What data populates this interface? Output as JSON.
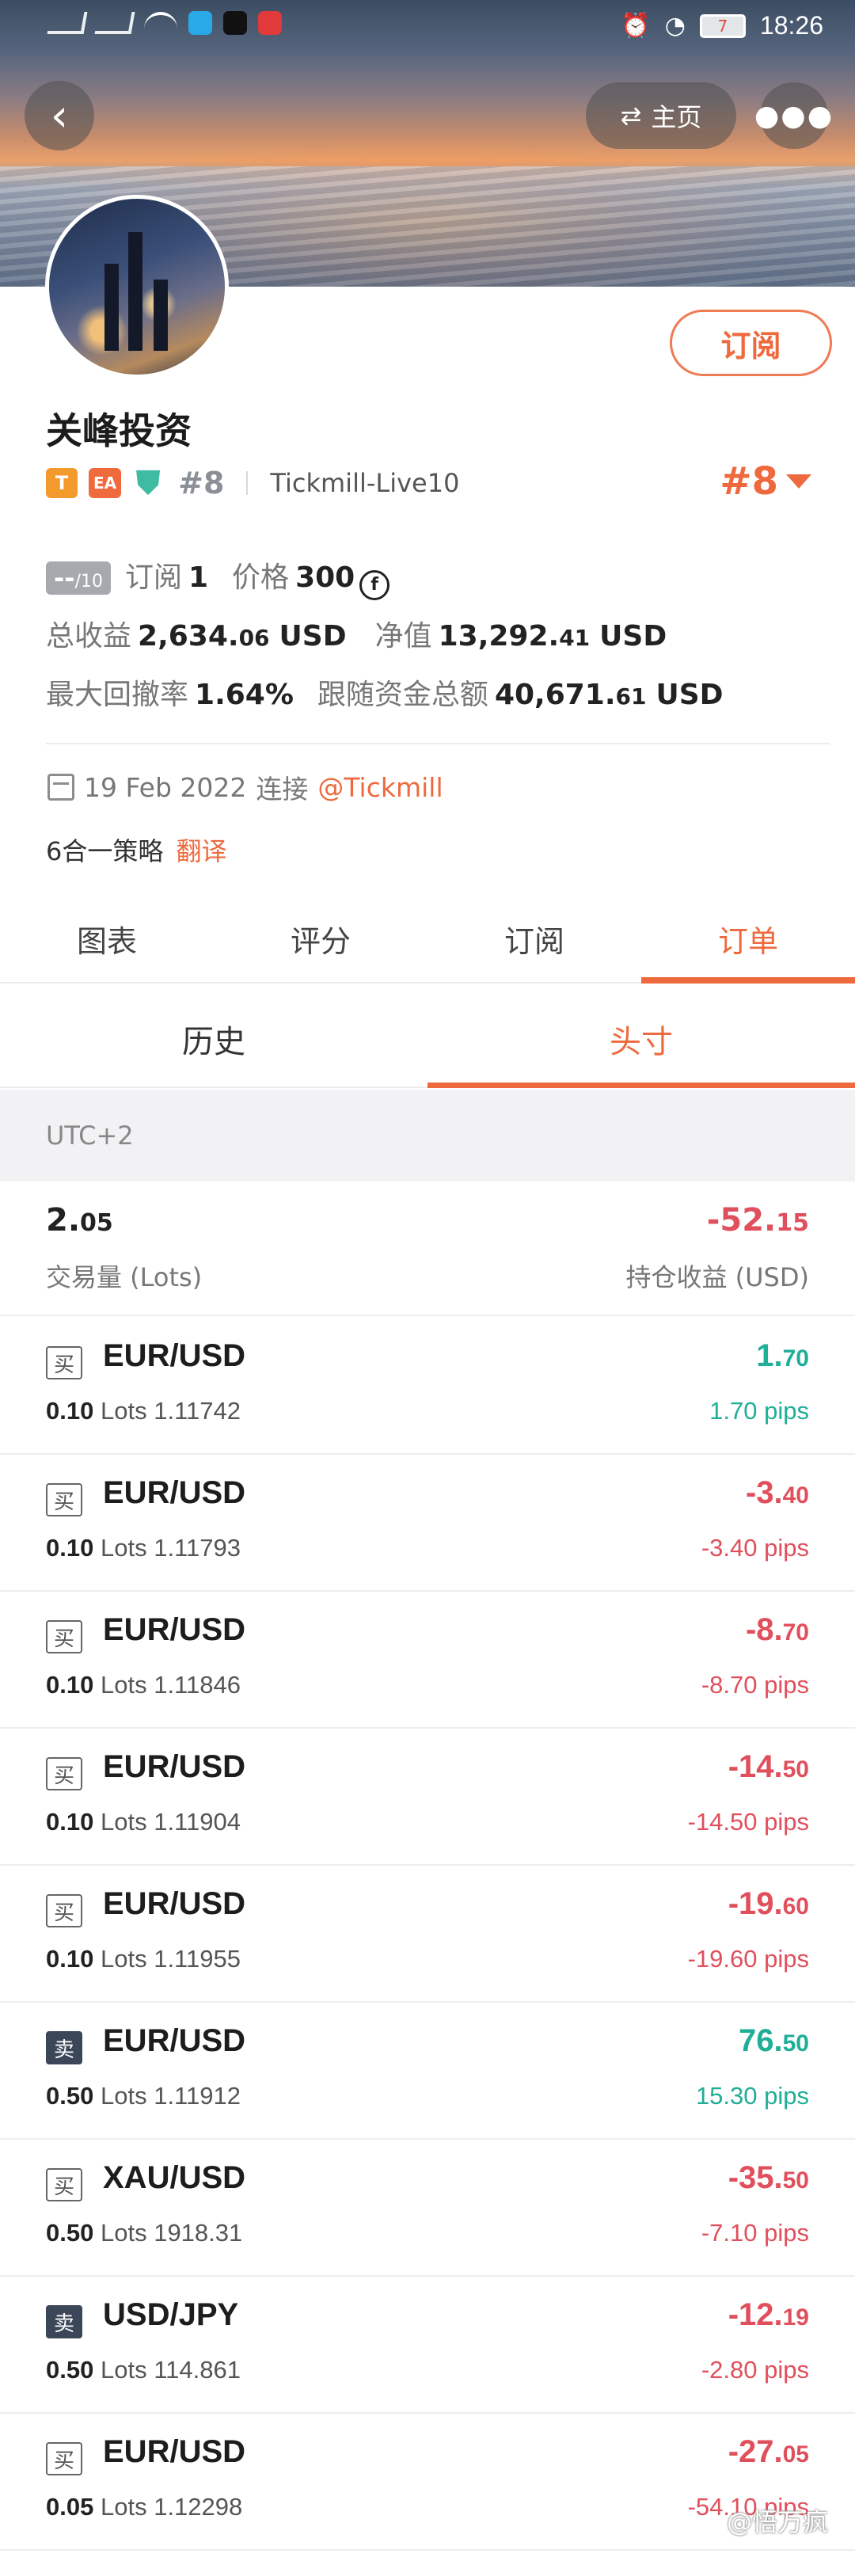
{
  "statusbar": {
    "time": "18:26",
    "battery": "7"
  },
  "header": {
    "home_label": "主页",
    "back_icon": "chevron-left-icon",
    "more_icon": "ellipsis-icon",
    "swap_icon": "swap-arrows-icon"
  },
  "profile": {
    "subscribe_label": "订阅",
    "name": "关峰投资",
    "badge_t": "T",
    "badge_ea": "EA",
    "rank_small": "#8",
    "broker": "Tickmill-Live10",
    "rank_big": "#8"
  },
  "stats": {
    "score": "--",
    "score_max": "/10",
    "subs_label": "订阅",
    "subs_value": "1",
    "price_label": "价格",
    "price_value": "300",
    "coin_symbol": "f",
    "total_profit_label": "总收益",
    "total_profit_main": "2,634.",
    "total_profit_dec": "06",
    "total_profit_unit": "USD",
    "equity_label": "净值",
    "equity_main": "13,292.",
    "equity_dec": "41",
    "equity_unit": "USD",
    "drawdown_label": "最大回撤率",
    "drawdown_value": "1.64%",
    "follow_label": "跟随资金总额",
    "follow_main": "40,671.",
    "follow_dec": "61",
    "follow_unit": "USD"
  },
  "connect": {
    "date": "19 Feb 2022",
    "label": "连接",
    "broker_link": "@Tickmill"
  },
  "strategy": {
    "text": "6合一策略",
    "translate": "翻译"
  },
  "tabs": [
    "图表",
    "评分",
    "订阅",
    "订单"
  ],
  "subtabs": [
    "历史",
    "头寸"
  ],
  "timezone": "UTC+2",
  "summary": {
    "volume_main": "2.",
    "volume_dec": "05",
    "volume_label": "交易量 (Lots)",
    "pnl_main": "-52.",
    "pnl_dec": "15",
    "pnl_label": "持仓收益 (USD)"
  },
  "orders": [
    {
      "side": "买",
      "type": "buy",
      "symbol": "EUR/USD",
      "lots": "0.10",
      "lots_unit": "Lots",
      "price": "1.11742",
      "pnl_main": "1.",
      "pnl_dec": "70",
      "pips": "1.70 pips",
      "sign": "pos"
    },
    {
      "side": "买",
      "type": "buy",
      "symbol": "EUR/USD",
      "lots": "0.10",
      "lots_unit": "Lots",
      "price": "1.11793",
      "pnl_main": "-3.",
      "pnl_dec": "40",
      "pips": "-3.40 pips",
      "sign": "neg"
    },
    {
      "side": "买",
      "type": "buy",
      "symbol": "EUR/USD",
      "lots": "0.10",
      "lots_unit": "Lots",
      "price": "1.11846",
      "pnl_main": "-8.",
      "pnl_dec": "70",
      "pips": "-8.70 pips",
      "sign": "neg"
    },
    {
      "side": "买",
      "type": "buy",
      "symbol": "EUR/USD",
      "lots": "0.10",
      "lots_unit": "Lots",
      "price": "1.11904",
      "pnl_main": "-14.",
      "pnl_dec": "50",
      "pips": "-14.50 pips",
      "sign": "neg"
    },
    {
      "side": "买",
      "type": "buy",
      "symbol": "EUR/USD",
      "lots": "0.10",
      "lots_unit": "Lots",
      "price": "1.11955",
      "pnl_main": "-19.",
      "pnl_dec": "60",
      "pips": "-19.60 pips",
      "sign": "neg"
    },
    {
      "side": "卖",
      "type": "sell",
      "symbol": "EUR/USD",
      "lots": "0.50",
      "lots_unit": "Lots",
      "price": "1.11912",
      "pnl_main": "76.",
      "pnl_dec": "50",
      "pips": "15.30 pips",
      "sign": "pos"
    },
    {
      "side": "买",
      "type": "buy",
      "symbol": "XAU/USD",
      "lots": "0.50",
      "lots_unit": "Lots",
      "price": "1918.31",
      "pnl_main": "-35.",
      "pnl_dec": "50",
      "pips": "-7.10 pips",
      "sign": "neg"
    },
    {
      "side": "卖",
      "type": "sell",
      "symbol": "USD/JPY",
      "lots": "0.50",
      "lots_unit": "Lots",
      "price": "114.861",
      "pnl_main": "-12.",
      "pnl_dec": "19",
      "pips": "-2.80 pips",
      "sign": "neg"
    },
    {
      "side": "买",
      "type": "buy",
      "symbol": "EUR/USD",
      "lots": "0.05",
      "lots_unit": "Lots",
      "price": "1.12298",
      "pnl_main": "-27.",
      "pnl_dec": "05",
      "pips": "-54.10 pips",
      "sign": "neg"
    }
  ],
  "watermark": "@悟万疯",
  "colors": {
    "accent": "#ee6a3e",
    "positive": "#1fae96",
    "negative": "#e04f5c"
  }
}
